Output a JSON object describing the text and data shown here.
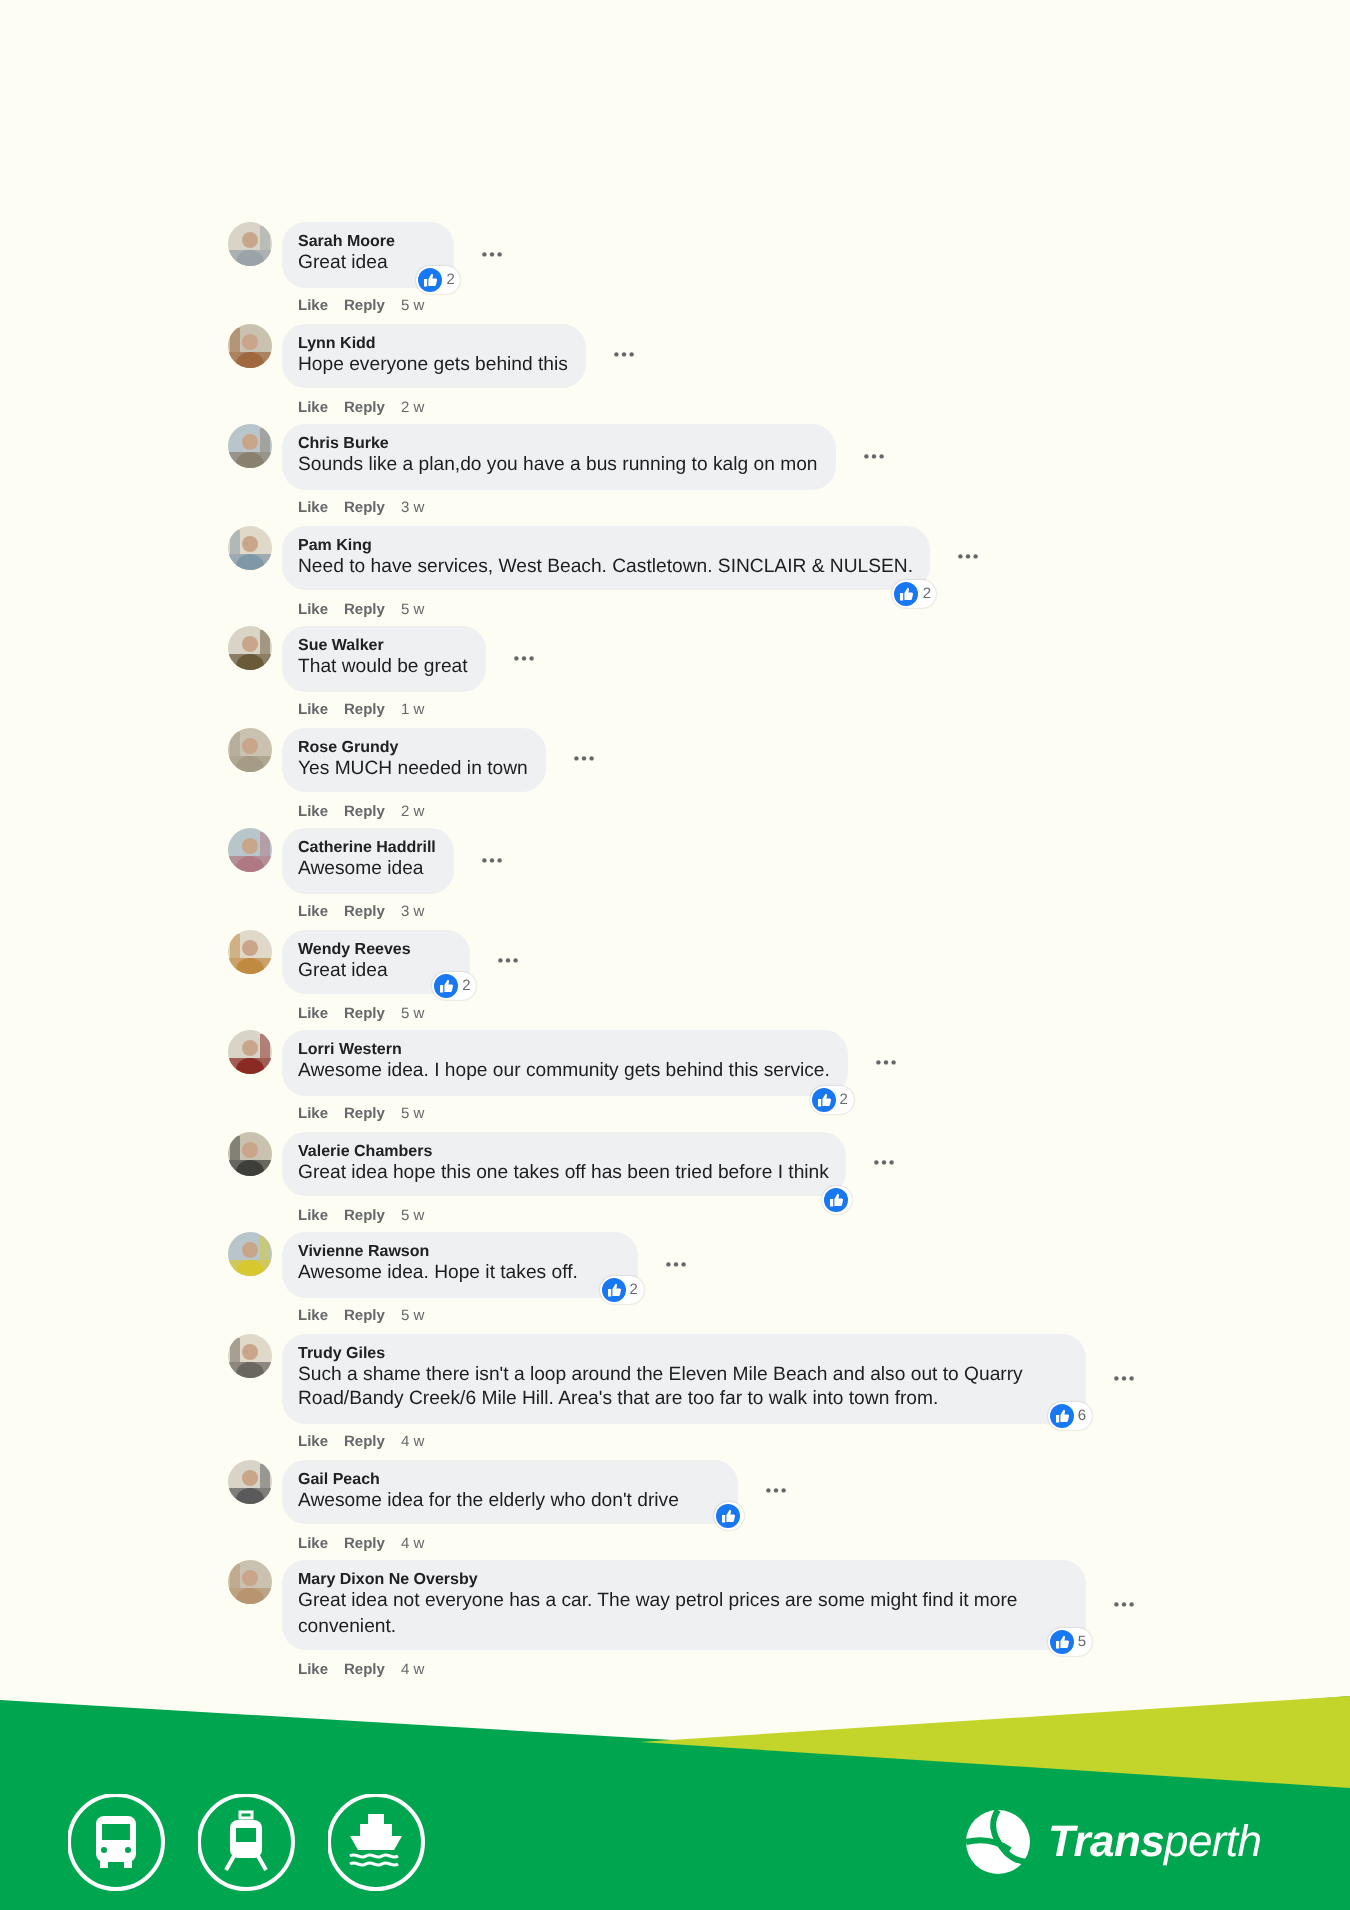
{
  "comments": [
    {
      "name": "Sarah Moore",
      "text": "Great idea",
      "actions": [
        "Like",
        "Reply"
      ],
      "time": "5 w",
      "reacted": true,
      "reaction_count": "2"
    },
    {
      "name": "Lynn Kidd",
      "text": "Hope everyone gets behind this",
      "actions": [
        "Like",
        "Reply"
      ],
      "time": "2 w",
      "reacted": false
    },
    {
      "name": "Chris Burke",
      "text": "Sounds like a plan,do you have a bus running to kalg on mon",
      "actions": [
        "Like",
        "Reply"
      ],
      "time": "3 w",
      "reacted": false
    },
    {
      "name": "Pam King",
      "text": "Need to have services, West Beach. Castletown. SINCLAIR & NULSEN.",
      "actions": [
        "Like",
        "Reply"
      ],
      "time": "5 w",
      "reacted": true,
      "reaction_count": "2"
    },
    {
      "name": "Sue Walker",
      "text": "That would be great",
      "actions": [
        "Like",
        "Reply"
      ],
      "time": "1 w",
      "reacted": false
    },
    {
      "name": "Rose Grundy",
      "text": "Yes MUCH needed in town",
      "actions": [
        "Like",
        "Reply"
      ],
      "time": "2 w",
      "reacted": false
    },
    {
      "name": "Catherine Haddrill",
      "text": "Awesome idea",
      "actions": [
        "Like",
        "Reply"
      ],
      "time": "3 w",
      "reacted": false
    },
    {
      "name": "Wendy Reeves",
      "text": "Great idea",
      "actions": [
        "Like",
        "Reply"
      ],
      "time": "5 w",
      "reacted": true,
      "reaction_count": "2"
    },
    {
      "name": "Lorri Western",
      "text": "Awesome idea. I hope our community gets behind this service.",
      "actions": [
        "Like",
        "Reply"
      ],
      "time": "5 w",
      "reacted": true,
      "reaction_count": "2"
    },
    {
      "name": "Valerie Chambers",
      "text": "Great idea hope this one takes off has been tried before I think",
      "actions": [
        "Like",
        "Reply"
      ],
      "time": "5 w",
      "reacted": true
    },
    {
      "name": "Vivienne Rawson",
      "text": "Awesome idea. Hope it takes off.",
      "actions": [
        "Like",
        "Reply"
      ],
      "time": "5 w",
      "reacted": true,
      "reaction_count": "2"
    },
    {
      "name": "Trudy Giles",
      "text": "Such a shame there isn't a loop around the Eleven Mile Beach and also out to Quarry Road/Bandy Creek/6 Mile Hill. Area's that are too far to walk into town from.",
      "actions": [
        "Like",
        "Reply"
      ],
      "time": "4 w",
      "reacted": true,
      "reaction_count": "6"
    },
    {
      "name": "Gail Peach",
      "text": "Awesome idea for the elderly who don't drive",
      "actions": [
        "Like",
        "Reply"
      ],
      "time": "4 w",
      "reacted": true
    },
    {
      "name": "Mary Dixon Ne Oversby",
      "text": "Great idea not everyone has a car. The way petrol prices are some might find it more convenient.",
      "actions": [
        "Like",
        "Reply"
      ],
      "time": "4 w",
      "reacted": true,
      "reaction_count": "5"
    }
  ],
  "footer": {
    "modes": [
      {
        "kind": "bus"
      },
      {
        "kind": "train"
      },
      {
        "kind": "ferry"
      }
    ],
    "logo": "**Trans**perth"
  }
}
